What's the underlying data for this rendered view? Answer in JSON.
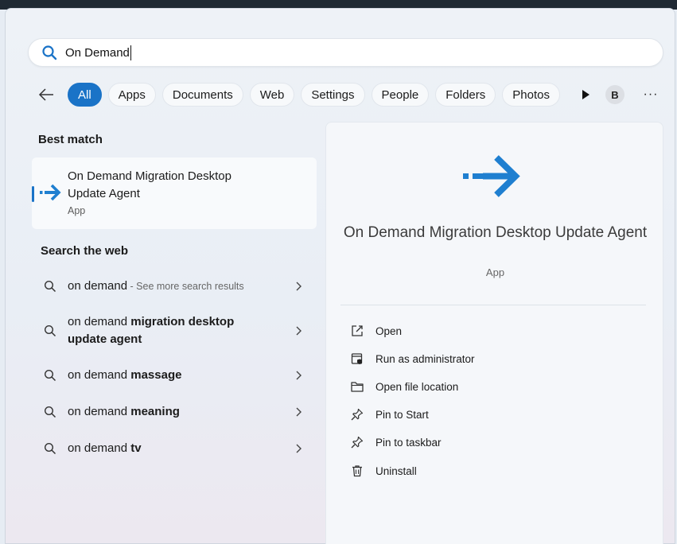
{
  "search": {
    "value": "On Demand"
  },
  "filters": {
    "items": [
      "All",
      "Apps",
      "Documents",
      "Web",
      "Settings",
      "People",
      "Folders",
      "Photos"
    ],
    "active": "All",
    "avatar_initial": "B",
    "more_label": "···"
  },
  "best_match": {
    "section_label": "Best match",
    "title": "On Demand Migration Desktop Update Agent",
    "subtitle": "App"
  },
  "web": {
    "section_label": "Search the web",
    "items": [
      {
        "plain": "on demand",
        "bold": "",
        "hint": " - See more search results"
      },
      {
        "plain": "on demand ",
        "bold": "migration desktop update agent",
        "hint": ""
      },
      {
        "plain": "on demand ",
        "bold": "massage",
        "hint": ""
      },
      {
        "plain": "on demand ",
        "bold": "meaning",
        "hint": ""
      },
      {
        "plain": "on demand ",
        "bold": "tv",
        "hint": ""
      }
    ]
  },
  "detail": {
    "title": "On Demand Migration Desktop Update Agent",
    "subtitle": "App",
    "actions": [
      {
        "label": "Open",
        "icon": "open-external-icon"
      },
      {
        "label": "Run as administrator",
        "icon": "shield-admin-icon"
      },
      {
        "label": "Open file location",
        "icon": "folder-icon"
      },
      {
        "label": "Pin to Start",
        "icon": "pin-icon"
      },
      {
        "label": "Pin to taskbar",
        "icon": "pin-icon"
      },
      {
        "label": "Uninstall",
        "icon": "trash-icon"
      }
    ]
  },
  "colors": {
    "accent": "#1a73c7",
    "icon_blue": "#1f7fd0"
  }
}
